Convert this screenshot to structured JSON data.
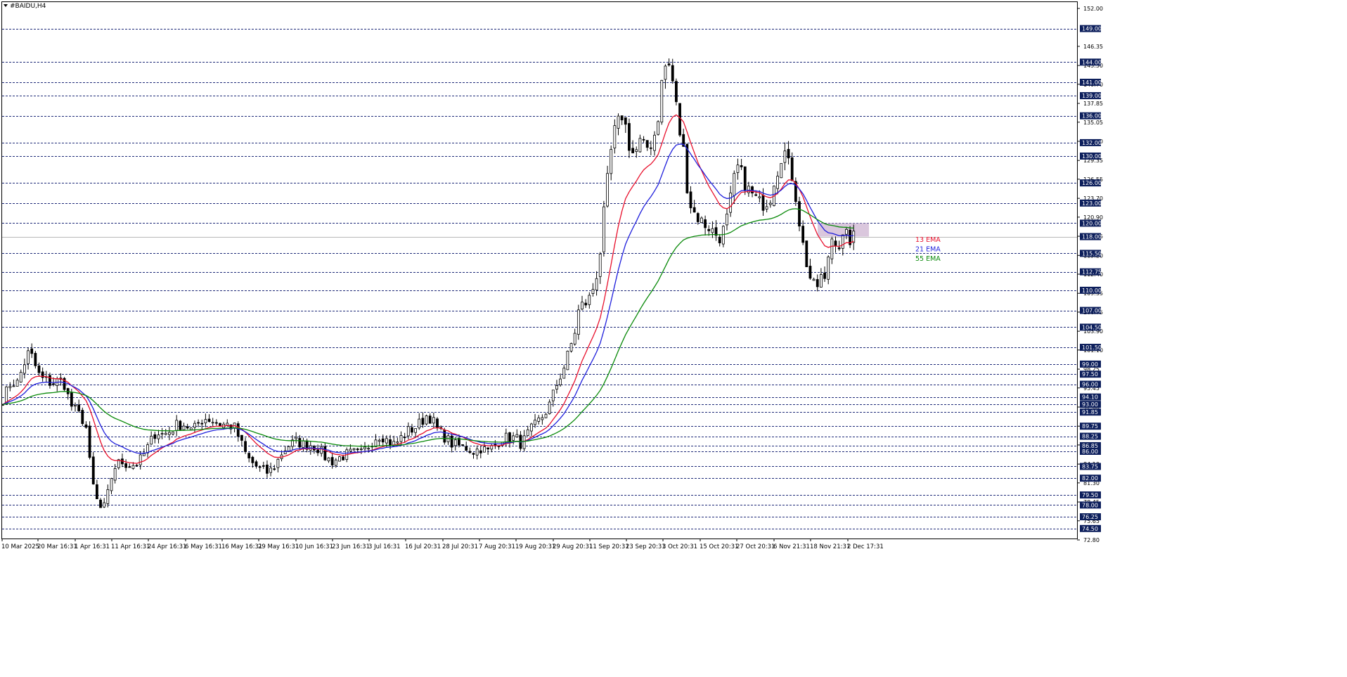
{
  "window": {
    "title": "#BAIDU,H4"
  },
  "chart_data": {
    "type": "candlestick",
    "symbol": "#BAIDU",
    "timeframe": "H4",
    "ylim": [
      72.8,
      152.0
    ],
    "axis_ticks": [
      152.0,
      146.35,
      143.5,
      140.7,
      137.85,
      135.05,
      132.2,
      129.35,
      126.55,
      123.7,
      120.9,
      118.05,
      115.2,
      112.4,
      109.55,
      106.75,
      103.9,
      101.1,
      98.25,
      95.45,
      92.6,
      89.75,
      86.95,
      84.1,
      81.3,
      78.45,
      75.65,
      72.8
    ],
    "levels": [
      149.0,
      144.0,
      141.0,
      139.0,
      136.0,
      132.0,
      130.0,
      126.0,
      123.0,
      120.0,
      118.0,
      115.5,
      112.75,
      110.0,
      107.0,
      104.5,
      101.5,
      99.0,
      97.5,
      96.0,
      94.1,
      93.0,
      91.85,
      89.75,
      88.25,
      86.85,
      86.0,
      83.75,
      82.0,
      79.5,
      78.0,
      76.25,
      74.5
    ],
    "current_price": 118.0,
    "x_labels": [
      "10 Mar 2025",
      "20 Mar 16:31",
      "1 Apr 16:31",
      "11 Apr 16:31",
      "24 Apr 16:31",
      "6 May 16:31",
      "16 May 16:31",
      "29 May 16:31",
      "10 Jun 16:31",
      "23 Jun 16:31",
      "3 Jul 16:31",
      "16 Jul 20:31",
      "28 Jul 20:31",
      "7 Aug 20:31",
      "19 Aug 20:31",
      "29 Aug 20:31",
      "11 Sep 20:31",
      "23 Sep 20:31",
      "3 Oct 20:31",
      "15 Oct 20:31",
      "27 Oct 20:31",
      "6 Nov 21:31",
      "18 Nov 21:31",
      "2 Dec 17:31"
    ],
    "price_path": [
      [
        0,
        93.5
      ],
      [
        8,
        95
      ],
      [
        14,
        96.5
      ],
      [
        22,
        96
      ],
      [
        32,
        99
      ],
      [
        40,
        101
      ],
      [
        47,
        99
      ],
      [
        55,
        97
      ],
      [
        62,
        96.5
      ],
      [
        72,
        96.2
      ],
      [
        82,
        96.5
      ],
      [
        90,
        96
      ],
      [
        98,
        93
      ],
      [
        106,
        92
      ],
      [
        114,
        91
      ],
      [
        120,
        90
      ],
      [
        126,
        84
      ],
      [
        132,
        80
      ],
      [
        138,
        78
      ],
      [
        144,
        77
      ],
      [
        150,
        79
      ],
      [
        156,
        82
      ],
      [
        162,
        83.8
      ],
      [
        170,
        84.5
      ],
      [
        180,
        84
      ],
      [
        190,
        84
      ],
      [
        200,
        85
      ],
      [
        210,
        87
      ],
      [
        220,
        89
      ],
      [
        230,
        88.5
      ],
      [
        240,
        89
      ],
      [
        250,
        90
      ],
      [
        262,
        90
      ],
      [
        272,
        89
      ],
      [
        282,
        90.5
      ],
      [
        292,
        91
      ],
      [
        302,
        90.5
      ],
      [
        312,
        90
      ],
      [
        322,
        90
      ],
      [
        332,
        89.5
      ],
      [
        340,
        87.5
      ],
      [
        350,
        85
      ],
      [
        360,
        84
      ],
      [
        370,
        83.2
      ],
      [
        380,
        82.8
      ],
      [
        390,
        84
      ],
      [
        400,
        86
      ],
      [
        410,
        87
      ],
      [
        420,
        87.5
      ],
      [
        430,
        87
      ],
      [
        440,
        87
      ],
      [
        450,
        86.5
      ],
      [
        460,
        85.2
      ],
      [
        470,
        84.5
      ],
      [
        480,
        85
      ],
      [
        490,
        85.5
      ],
      [
        500,
        85.8
      ],
      [
        510,
        85.5
      ],
      [
        520,
        86.5
      ],
      [
        530,
        88
      ],
      [
        540,
        88.5
      ],
      [
        550,
        87.5
      ],
      [
        560,
        87
      ],
      [
        568,
        88
      ],
      [
        578,
        89
      ],
      [
        588,
        89.5
      ],
      [
        598,
        90.5
      ],
      [
        606,
        91.5
      ],
      [
        614,
        90.5
      ],
      [
        622,
        89
      ],
      [
        632,
        88
      ],
      [
        642,
        87
      ],
      [
        652,
        86.8
      ],
      [
        662,
        86.5
      ],
      [
        672,
        86
      ],
      [
        682,
        86.5
      ],
      [
        692,
        86
      ],
      [
        702,
        87
      ],
      [
        712,
        88
      ],
      [
        722,
        88
      ],
      [
        732,
        88
      ],
      [
        740,
        87
      ],
      [
        748,
        88.5
      ],
      [
        756,
        89.5
      ],
      [
        764,
        90.5
      ],
      [
        772,
        91.5
      ],
      [
        780,
        93
      ],
      [
        790,
        96
      ],
      [
        800,
        98.5
      ],
      [
        808,
        101
      ],
      [
        816,
        104
      ],
      [
        822,
        107.5
      ],
      [
        830,
        108
      ],
      [
        838,
        109
      ],
      [
        846,
        112
      ],
      [
        852,
        116
      ],
      [
        858,
        122.5
      ],
      [
        864,
        128
      ],
      [
        870,
        133
      ],
      [
        876,
        134.5
      ],
      [
        884,
        136.5
      ],
      [
        892,
        132
      ],
      [
        900,
        130
      ],
      [
        908,
        132
      ],
      [
        916,
        131
      ],
      [
        924,
        132
      ],
      [
        932,
        134
      ],
      [
        940,
        141.5
      ],
      [
        946,
        144
      ],
      [
        952,
        143
      ],
      [
        958,
        139
      ],
      [
        964,
        134
      ],
      [
        970,
        131
      ],
      [
        976,
        125
      ],
      [
        982,
        122
      ],
      [
        990,
        121
      ],
      [
        998,
        120
      ],
      [
        1006,
        119.5
      ],
      [
        1014,
        118.5
      ],
      [
        1022,
        118
      ],
      [
        1030,
        119.5
      ],
      [
        1038,
        124
      ],
      [
        1046,
        128.5
      ],
      [
        1054,
        127
      ],
      [
        1062,
        125
      ],
      [
        1070,
        124
      ],
      [
        1078,
        123
      ],
      [
        1086,
        123
      ],
      [
        1094,
        124
      ],
      [
        1100,
        127
      ],
      [
        1106,
        128.5
      ],
      [
        1112,
        131.5
      ],
      [
        1118,
        129
      ],
      [
        1124,
        127.5
      ],
      [
        1130,
        124
      ],
      [
        1136,
        119.5
      ],
      [
        1142,
        115.5
      ],
      [
        1150,
        112
      ],
      [
        1158,
        110
      ],
      [
        1166,
        112
      ],
      [
        1172,
        111
      ],
      [
        1178,
        117
      ],
      [
        1184,
        118.5
      ],
      [
        1190,
        116.5
      ],
      [
        1196,
        117.5
      ],
      [
        1202,
        118
      ],
      [
        1208,
        117.5
      ],
      [
        1214,
        118
      ],
      [
        1220,
        118
      ]
    ],
    "series": [
      {
        "name": "13 EMA",
        "color": "#e8102c",
        "period": 13
      },
      {
        "name": "21 EMA",
        "color": "#1f1fdc",
        "period": 21
      },
      {
        "name": "55 EMA",
        "color": "#0a8a0a",
        "period": 55
      }
    ],
    "zone": {
      "price_low": 118.0,
      "price_high": 120.0,
      "color": "#cdb4d2"
    },
    "grid": "horizontal-dashed",
    "legend": "right-of-last-bar"
  }
}
